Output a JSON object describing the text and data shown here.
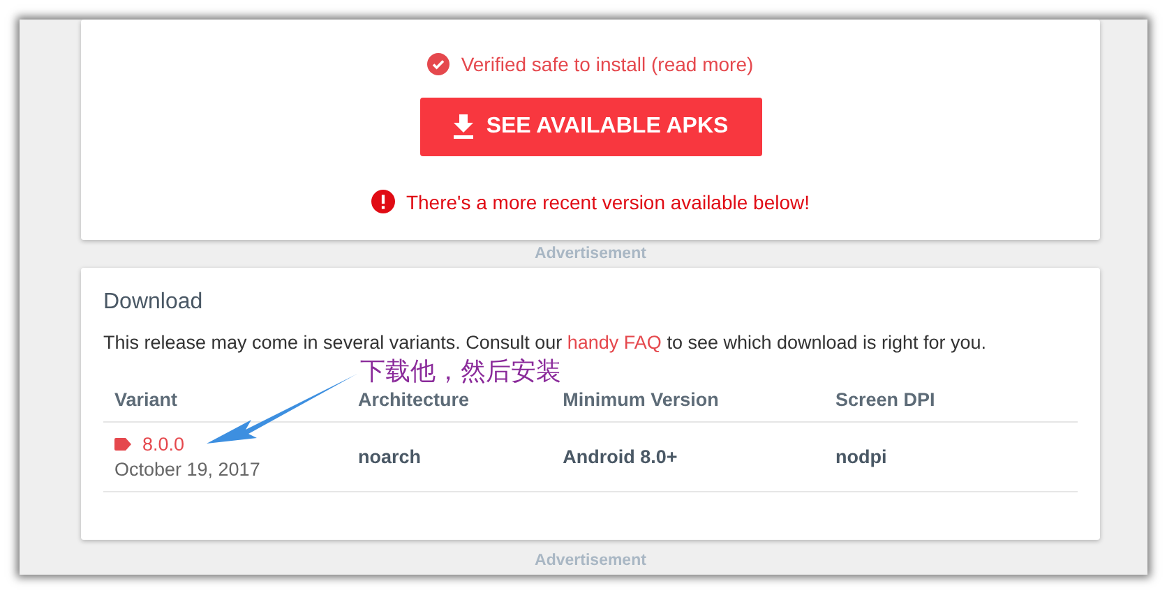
{
  "install": {
    "verified": "Verified safe to install (read more)",
    "button": "SEE AVAILABLE APKS",
    "warning": "There's a more recent version available below!"
  },
  "ads": [
    "Advertisement",
    "Advertisement"
  ],
  "download": {
    "title": "Download",
    "description_before": "This release may come in several variants. Consult our",
    "link": "handy FAQ",
    "description_after": "to see which download is right for you.",
    "columns": [
      "Variant",
      "Architecture",
      "Minimum Version",
      "Screen DPI"
    ],
    "rows": [
      {
        "version": "8.0.0",
        "date": "October 19, 2017",
        "architecture": "noarch",
        "min_version": "Android 8.0+",
        "dpi": "nodpi"
      }
    ]
  },
  "annotation": {
    "text": "下载他，然后安装"
  }
}
